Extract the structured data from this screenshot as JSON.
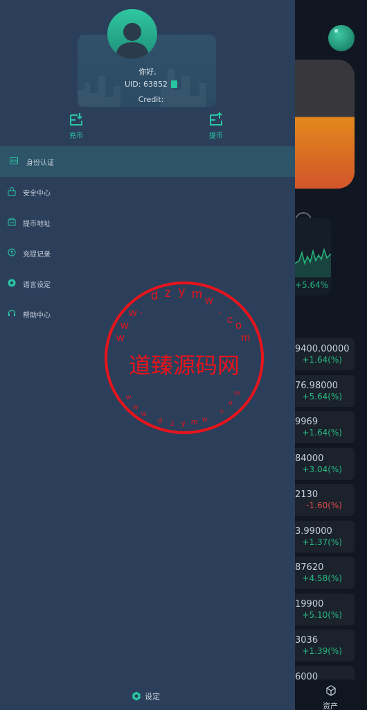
{
  "header": {
    "greeting": "你好,",
    "uid": "UID: 63852",
    "credit": "Credit:"
  },
  "quick_actions": [
    {
      "label": "充币"
    },
    {
      "label": "提币"
    }
  ],
  "menu": [
    {
      "label": "身份认证",
      "icon": "id-card-icon",
      "active": true
    },
    {
      "label": "安全中心",
      "icon": "lock-icon",
      "active": false
    },
    {
      "label": "提币地址",
      "icon": "address-icon",
      "active": false
    },
    {
      "label": "充提记录",
      "icon": "record-icon",
      "active": false
    },
    {
      "label": "语言设定",
      "icon": "language-icon",
      "active": false
    },
    {
      "label": "帮助中心",
      "icon": "headset-icon",
      "active": false
    }
  ],
  "footer": {
    "settings_label": "设定"
  },
  "background": {
    "mini_card_change": "+5.64%",
    "tickers": [
      {
        "price": "9400.00000",
        "change": "+1.64(%)",
        "dir": "up"
      },
      {
        "price": "76.98000",
        "change": "+5.64(%)",
        "dir": "up"
      },
      {
        "price": "9969",
        "change": "+1.64(%)",
        "dir": "up"
      },
      {
        "price": "84000",
        "change": "+3.04(%)",
        "dir": "up"
      },
      {
        "price": "2130",
        "change": "-1.60(%)",
        "dir": "down"
      },
      {
        "price": "3.99000",
        "change": "+1.37(%)",
        "dir": "up"
      },
      {
        "price": "87620",
        "change": "+4.58(%)",
        "dir": "up"
      },
      {
        "price": "19900",
        "change": "+5.10(%)",
        "dir": "up"
      },
      {
        "price": "3036",
        "change": "+1.39(%)",
        "dir": "up"
      },
      {
        "price": "6000",
        "change": "",
        "dir": "up"
      }
    ],
    "tab_label": "资产"
  },
  "watermark": {
    "text": "道臻源码网",
    "url": "www.dzym.com"
  },
  "colors": {
    "drawer_bg": "#2b3f5b",
    "accent": "#29c7a2",
    "up": "#26b980",
    "down": "#e14a4a",
    "stamp": "#e8141c"
  }
}
